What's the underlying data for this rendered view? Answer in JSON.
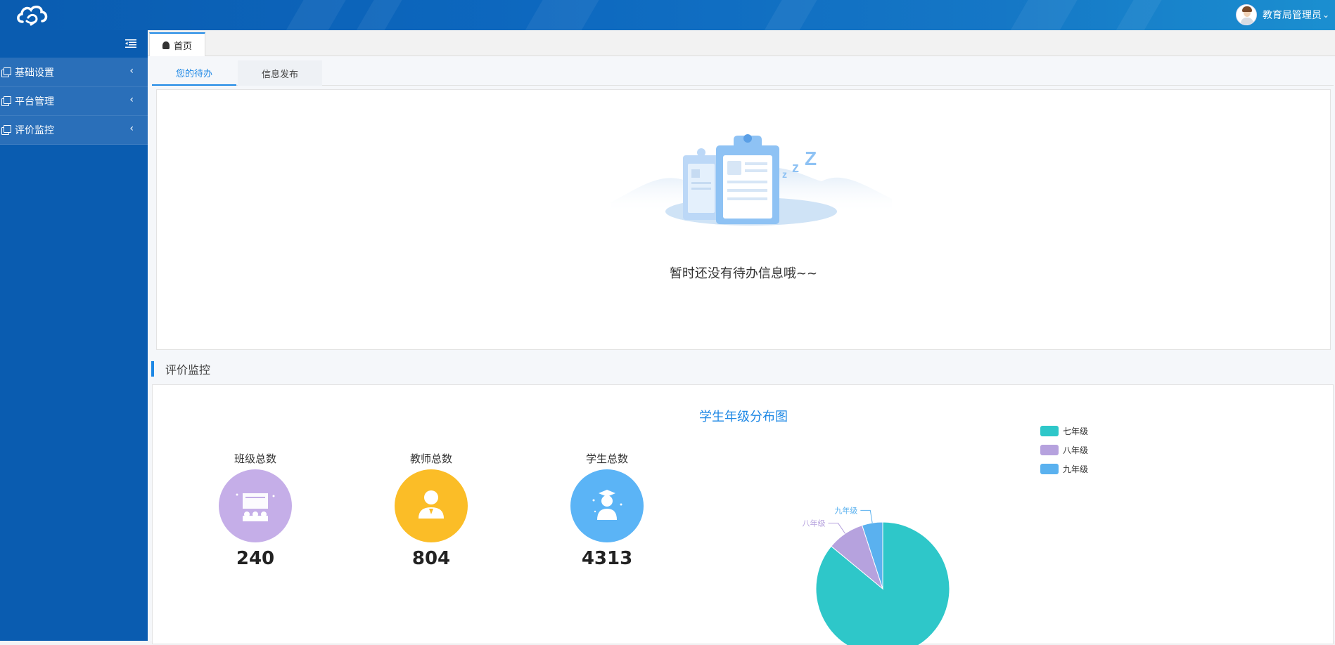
{
  "header": {
    "user_name": "教育局管理员",
    "user_chevron": "⌄"
  },
  "sidebar": {
    "items": [
      {
        "label": "基础设置",
        "arrow": "‹"
      },
      {
        "label": "平台管理",
        "arrow": "‹"
      },
      {
        "label": "评价监控",
        "arrow": "‹"
      }
    ]
  },
  "tabs": {
    "home_label": "首页"
  },
  "subtabs": {
    "todo_label": "您的待办",
    "publish_label": "信息发布"
  },
  "todo": {
    "empty_text": "暂时还没有待办信息哦~~"
  },
  "section": {
    "title": "评价监控"
  },
  "stats": [
    {
      "label": "班级总数",
      "value": "240",
      "color": "#c5aee8",
      "icon": "classroom-icon"
    },
    {
      "label": "教师总数",
      "value": "804",
      "color": "#fbbd27",
      "icon": "teacher-icon"
    },
    {
      "label": "学生总数",
      "value": "4313",
      "color": "#5bb4f6",
      "icon": "student-icon"
    }
  ],
  "chart_data": {
    "type": "pie",
    "title": "学生年级分布图",
    "categories": [
      "七年级",
      "八年级",
      "九年级"
    ],
    "values": [
      86,
      9,
      5
    ],
    "colors": [
      "#2ec7c9",
      "#b6a2de",
      "#5ab1ef"
    ],
    "legend_position": "top-right"
  }
}
